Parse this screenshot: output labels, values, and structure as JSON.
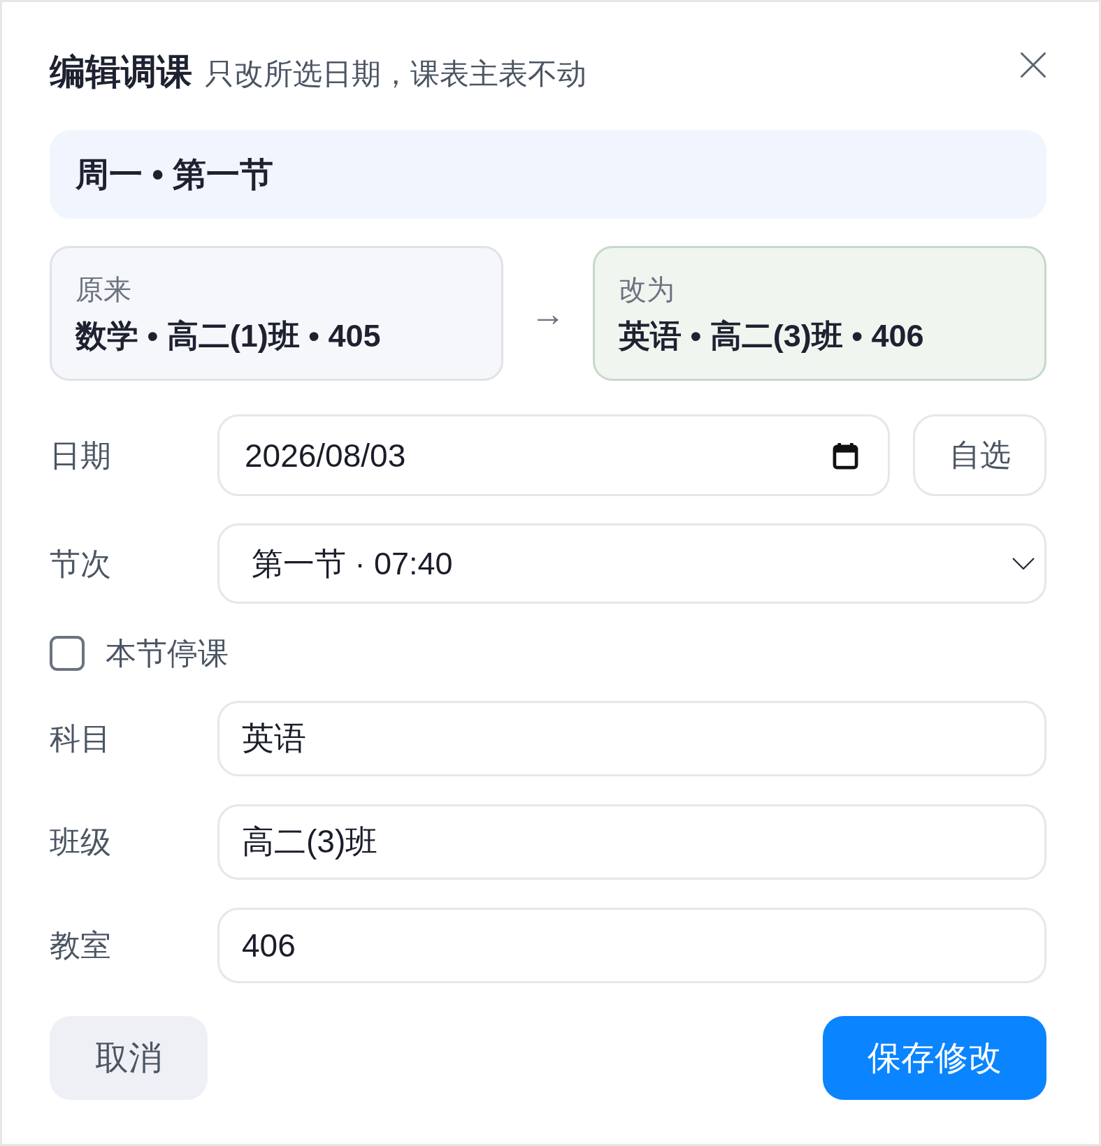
{
  "dialog": {
    "title": "编辑调课",
    "subtitle": "只改所选日期，课表主表不动"
  },
  "slot": "周一 • 第一节",
  "comparison": {
    "before": {
      "label": "原来",
      "value": "数学 • 高二(1)班 • 405"
    },
    "arrow": "→",
    "after": {
      "label": "改为",
      "value": "英语 • 高二(3)班 • 406"
    }
  },
  "form": [
    {
      "kind": "date",
      "label": "日期",
      "value": "2026/08/03",
      "button": "自选"
    },
    {
      "kind": "select",
      "label": "节次",
      "value": "第一节 · 07:40"
    },
    {
      "kind": "checkbox",
      "label": "本节停课",
      "checked": false
    },
    {
      "kind": "text",
      "label": "科目",
      "value": "英语"
    },
    {
      "kind": "text",
      "label": "班级",
      "value": "高二(3)班"
    },
    {
      "kind": "text",
      "label": "教室",
      "value": "406"
    }
  ],
  "buttons": [
    {
      "kind": "secondary",
      "label": "取消"
    },
    {
      "kind": "primary",
      "label": "保存修改"
    }
  ]
}
